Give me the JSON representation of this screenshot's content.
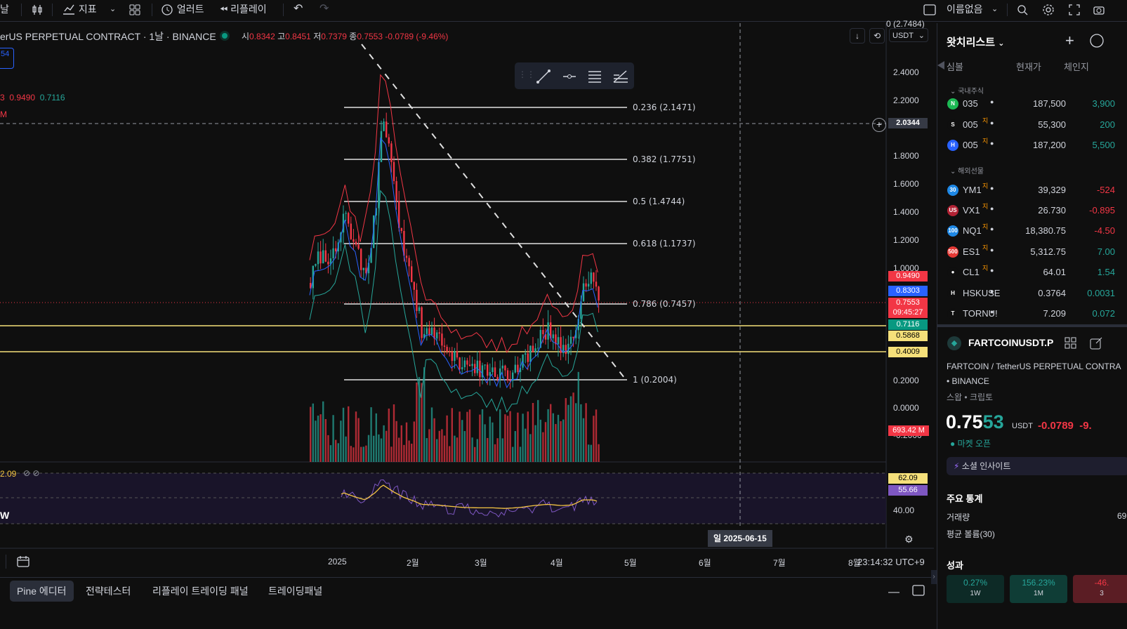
{
  "toolbar": {
    "interval_fragment": "날",
    "indicators": "지표",
    "alerts": "얼러트",
    "replay": "리플레이",
    "layout_name": "이름없음"
  },
  "legend": {
    "title": "erUS PERPETUAL CONTRACT · 1날 · BINANCE",
    "open_label": "시",
    "open": "0.8342",
    "high_label": "고",
    "high": "0.8451",
    "low_label": "저",
    "low": "0.7379",
    "close_label": "종",
    "close": "0.7553",
    "change": "-0.0789 (-9.46%)",
    "badge": "54",
    "bb_values": [
      "3",
      "0.9490",
      "0.7116"
    ],
    "vol_label": "M",
    "rsi_label": "2.09",
    "rsi_footer": "W"
  },
  "chart_controls": {
    "currency": "USDT"
  },
  "drawing_toolbar": [
    "trend-line-tool",
    "horizontal-ray-tool",
    "fib-tool",
    "pitchfork-tool"
  ],
  "price_axis": [
    "2.4000",
    "2.2000",
    "1.8000",
    "1.6000",
    "1.4000",
    "1.2000",
    "1.0000",
    "0.2000",
    "0.0000",
    "-0.2000",
    "40.00"
  ],
  "price_axis_top_partial": "0 (2.7484)",
  "crosshair_price": "2.0344",
  "price_boxes": {
    "bb_upper": "0.9490",
    "ma": "0.8303",
    "last": "0.7553",
    "countdown": "09:45:27",
    "bb_lower": "0.7116",
    "line1": "0.5868",
    "line2": "0.4009",
    "volume": "693.42 M",
    "rsi1": "62.09",
    "rsi2": "55.66"
  },
  "fib_levels": [
    {
      "label": "0.236 (2.1471)"
    },
    {
      "label": "0.382 (1.7751)"
    },
    {
      "label": "0.5 (1.4744)"
    },
    {
      "label": "0.618 (1.1737)"
    },
    {
      "label": "0.786 (0.7457)"
    },
    {
      "label": "1 (0.2004)"
    }
  ],
  "time_axis": [
    "2025",
    "2월",
    "3월",
    "4월",
    "5월",
    "6월",
    "7월",
    "8월"
  ],
  "crosshair_date": "일 2025-06-15",
  "clock": "23:14:32 UTC+9",
  "bottom_tabs": [
    "Pine 에디터",
    "전략테스터",
    "리플레이 트레이딩 패널",
    "트레이딩패널"
  ],
  "watchlist": {
    "title": "왓치리스트",
    "headers": {
      "symbol": "심볼",
      "price": "현재가",
      "change": "체인지"
    },
    "section_domestic": "국내주식",
    "section_overseas": "해외선물",
    "rows": [
      {
        "icon": "N",
        "icon_color": "#1db954",
        "symbol": "035",
        "sup": "",
        "price": "187,500",
        "change": "3,900",
        "dir": "up"
      },
      {
        "icon": "S",
        "icon_color": "#0f0f0f",
        "symbol": "005",
        "sup": "지",
        "price": "55,300",
        "change": "200",
        "dir": "up"
      },
      {
        "icon": "H",
        "icon_color": "#2962ff",
        "symbol": "005",
        "sup": "지",
        "price": "187,200",
        "change": "5,500",
        "dir": "up"
      },
      {
        "icon": "30",
        "icon_color": "#1e88e5",
        "symbol": "YM1",
        "sup": "지",
        "price": "39,329",
        "change": "-524",
        "dir": "down"
      },
      {
        "icon": "US",
        "icon_color": "#b22234",
        "symbol": "VX1",
        "sup": "지",
        "price": "26.730",
        "change": "-0.895",
        "dir": "down"
      },
      {
        "icon": "100",
        "icon_color": "#1e88e5",
        "symbol": "NQ1",
        "sup": "지",
        "price": "18,380.75",
        "change": "-4.50",
        "dir": "down"
      },
      {
        "icon": "500",
        "icon_color": "#e53935",
        "symbol": "ES1",
        "sup": "지",
        "price": "5,312.75",
        "change": "7.00",
        "dir": "up"
      },
      {
        "icon": "●",
        "icon_color": "#0f0f0f",
        "symbol": "CL1",
        "sup": "지",
        "price": "64.01",
        "change": "1.54",
        "dir": "up"
      },
      {
        "icon": "H",
        "icon_color": "#0f0f0f",
        "symbol": "HSKUSE",
        "sup": "",
        "price": "0.3764",
        "change": "0.0031",
        "dir": "up"
      },
      {
        "icon": "T",
        "icon_color": "#0f0f0f",
        "symbol": "TORNU!",
        "sup": "",
        "price": "7.209",
        "change": "0.072",
        "dir": "up"
      }
    ]
  },
  "details": {
    "symbol": "FARTCOINUSDT.P",
    "description": "FARTCOIN / TetherUS PERPETUAL CONTRA",
    "exchange": "• BINANCE",
    "tags": "스왑 • 크립토",
    "price_main": "0.75",
    "price_tail": "53",
    "currency": "USDT",
    "change": "-0.0789",
    "change_pct": "-9.",
    "market_status": "마켓 오픈",
    "social": "소셜 인사이트",
    "key_stats": "주요 통계",
    "volume_label": "거래량",
    "volume_value": "69",
    "avg_volume_label": "평균 볼륨(30)",
    "performance": "성과",
    "perf": [
      {
        "value": "0.27%",
        "period": "1W",
        "dir": "up"
      },
      {
        "value": "156.23%",
        "period": "1M",
        "dir": "up"
      },
      {
        "value": "-46.",
        "period": "3",
        "dir": "down"
      }
    ]
  },
  "colors": {
    "up": "#26a69a",
    "down": "#f23645",
    "accent": "#2962ff",
    "fib": "#e0e0e0",
    "yellow": "#f5e07a",
    "rsi": "#7e57c2"
  }
}
